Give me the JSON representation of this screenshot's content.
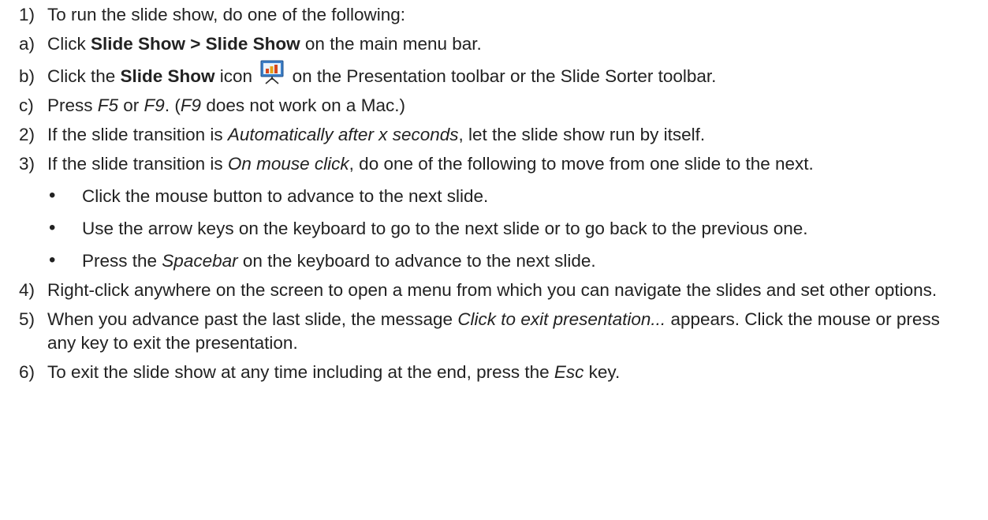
{
  "steps": {
    "s1": {
      "num": "1)",
      "text": "To run the slide show, do one of the following:"
    },
    "sa": {
      "num": "a)",
      "pre": "Click ",
      "bold": "Slide Show > Slide Show",
      "post": " on the main menu bar."
    },
    "sb": {
      "num": "b)",
      "pre": "Click the ",
      "bold": "Slide Show",
      "mid": " icon ",
      "post": " on the Presentation toolbar or the Slide Sorter toolbar.",
      "icon": "slide-show-icon"
    },
    "sc": {
      "num": "c)",
      "pre": "Press ",
      "i1": "F5",
      "m1": " or ",
      "i2": "F9",
      "m2": ". (",
      "i3": "F9",
      "post": " does not work on a Mac.)"
    },
    "s2": {
      "num": "2)",
      "pre": "If the slide transition is ",
      "ital": "Automatically after x seconds",
      "post": ", let the slide show run by itself."
    },
    "s3": {
      "num": "3)",
      "pre": "If the slide transition is ",
      "ital": "On mouse click",
      "post": ", do one of the following to move from one slide to the next."
    },
    "s4": {
      "num": "4)",
      "text": "Right-click anywhere on the screen to open a menu from which you can navigate the slides and set other options."
    },
    "s5": {
      "num": "5)",
      "pre": "When you advance past the last slide, the message ",
      "ital": "Click to exit presentation...",
      "post": " appears. Click the mouse or press any key to exit the presentation."
    },
    "s6": {
      "num": "6)",
      "pre": "To exit the slide show at any time including at the end, press the ",
      "ital": "Esc",
      "post": " key."
    }
  },
  "bullets": {
    "b1": {
      "dot": "•",
      "text": "Click the mouse button to advance to the next slide."
    },
    "b2": {
      "dot": "•",
      "text": "Use the arrow keys on the keyboard to go to the next slide or to go back to the previous one."
    },
    "b3": {
      "dot": "•",
      "pre": "Press the ",
      "ital": "Spacebar",
      "post": " on the keyboard to advance to the next slide."
    }
  },
  "colors": {
    "text": "#222222",
    "icon_screen": "#3d7fc7",
    "icon_bars_orange": "#e8a317",
    "icon_bars_red": "#d9461a"
  }
}
